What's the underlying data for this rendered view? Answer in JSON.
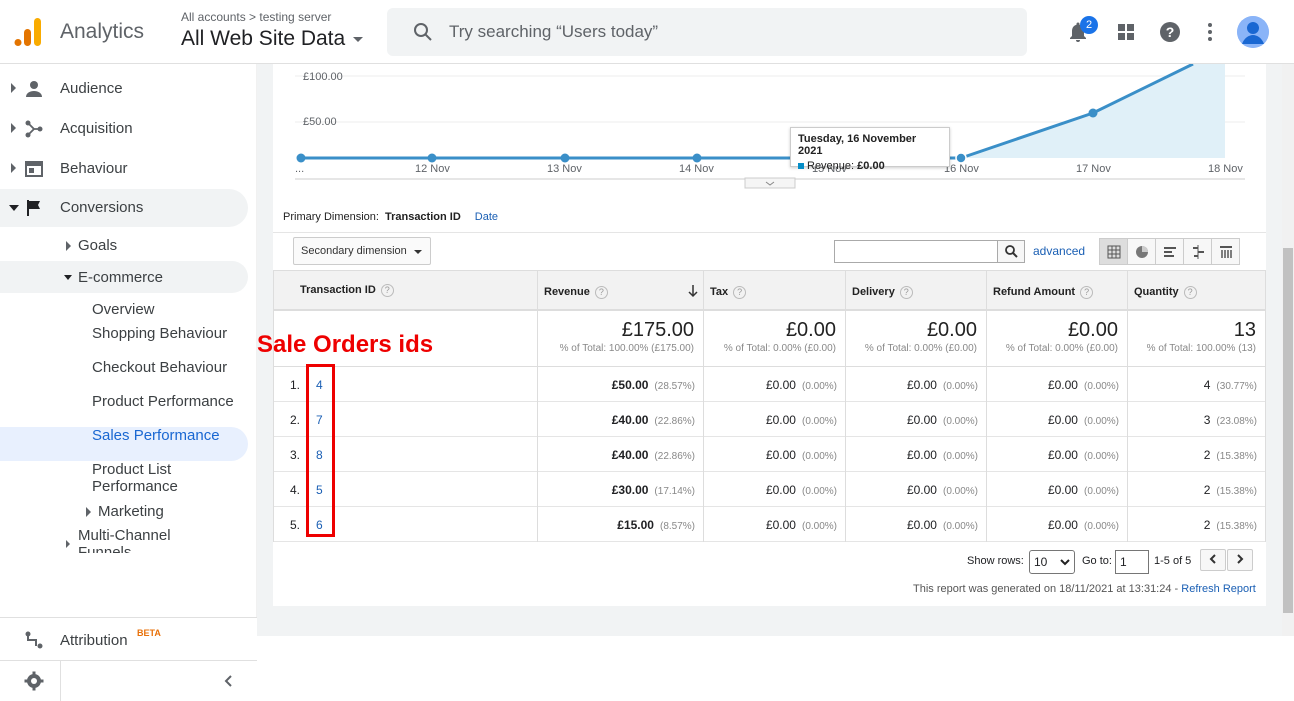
{
  "header": {
    "brand": "Analytics",
    "breadcrumb": "All accounts > testing server",
    "property": "All Web Site Data",
    "search_placeholder": "Try searching “Users today”",
    "notification_count": "2"
  },
  "sidebar": {
    "items": {
      "audience": "Audience",
      "acquisition": "Acquisition",
      "behaviour": "Behaviour",
      "conversions": "Conversions",
      "goals": "Goals",
      "ecommerce": "E-commerce",
      "overview": "Overview",
      "shopping_behaviour": "Shopping Behaviour",
      "checkout_behaviour": "Checkout Behaviour",
      "product_performance": "Product Performance",
      "sales_performance": "Sales Performance",
      "product_list_performance": "Product List Performance",
      "marketing": "Marketing",
      "multi_channel": "Multi-Channel Funnels",
      "attribution": "Attribution",
      "attribution_badge": "BETA"
    }
  },
  "chart": {
    "y_ticks": [
      "£100.00",
      "£50.00"
    ],
    "x_ticks": [
      "...",
      "12 Nov",
      "13 Nov",
      "14 Nov",
      "15 Nov",
      "16 Nov",
      "17 Nov",
      "18 Nov"
    ],
    "tooltip_date": "Tuesday, 16 November 2021",
    "tooltip_label": "Revenue:",
    "tooltip_value": "£0.00"
  },
  "controls": {
    "primary_dimension_label": "Primary Dimension:",
    "primary_dimension_selected": "Transaction ID",
    "primary_dimension_alt": "Date",
    "secondary_dimension": "Secondary dimension",
    "advanced": "advanced"
  },
  "table": {
    "columns": [
      "Transaction ID",
      "Revenue",
      "Tax",
      "Delivery",
      "Refund Amount",
      "Quantity"
    ],
    "totals": [
      {
        "value": "£175.00",
        "pct": "% of Total: 100.00% (£175.00)"
      },
      {
        "value": "£0.00",
        "pct": "% of Total: 0.00% (£0.00)"
      },
      {
        "value": "£0.00",
        "pct": "% of Total: 0.00% (£0.00)"
      },
      {
        "value": "£0.00",
        "pct": "% of Total: 0.00% (£0.00)"
      },
      {
        "value": "13",
        "pct": "% of Total: 100.00% (13)"
      }
    ],
    "rows": [
      {
        "n": "1.",
        "id": "4",
        "revenue": "£50.00",
        "revenue_pct": "(28.57%)",
        "tax": "£0.00",
        "tax_pct": "(0.00%)",
        "delivery": "£0.00",
        "delivery_pct": "(0.00%)",
        "refund": "£0.00",
        "refund_pct": "(0.00%)",
        "qty": "4",
        "qty_pct": "(30.77%)"
      },
      {
        "n": "2.",
        "id": "7",
        "revenue": "£40.00",
        "revenue_pct": "(22.86%)",
        "tax": "£0.00",
        "tax_pct": "(0.00%)",
        "delivery": "£0.00",
        "delivery_pct": "(0.00%)",
        "refund": "£0.00",
        "refund_pct": "(0.00%)",
        "qty": "3",
        "qty_pct": "(23.08%)"
      },
      {
        "n": "3.",
        "id": "8",
        "revenue": "£40.00",
        "revenue_pct": "(22.86%)",
        "tax": "£0.00",
        "tax_pct": "(0.00%)",
        "delivery": "£0.00",
        "delivery_pct": "(0.00%)",
        "refund": "£0.00",
        "refund_pct": "(0.00%)",
        "qty": "2",
        "qty_pct": "(15.38%)"
      },
      {
        "n": "4.",
        "id": "5",
        "revenue": "£30.00",
        "revenue_pct": "(17.14%)",
        "tax": "£0.00",
        "tax_pct": "(0.00%)",
        "delivery": "£0.00",
        "delivery_pct": "(0.00%)",
        "refund": "£0.00",
        "refund_pct": "(0.00%)",
        "qty": "2",
        "qty_pct": "(15.38%)"
      },
      {
        "n": "5.",
        "id": "6",
        "revenue": "£15.00",
        "revenue_pct": "(8.57%)",
        "tax": "£0.00",
        "tax_pct": "(0.00%)",
        "delivery": "£0.00",
        "delivery_pct": "(0.00%)",
        "refund": "£0.00",
        "refund_pct": "(0.00%)",
        "qty": "2",
        "qty_pct": "(15.38%)"
      }
    ]
  },
  "annotation": {
    "label": "Sale Orders ids"
  },
  "pager": {
    "show_rows_label": "Show rows:",
    "rows_value": "10",
    "goto_label": "Go to:",
    "goto_value": "1",
    "range": "1-5 of 5",
    "generated": "This report was generated on 18/11/2021 at 13:31:24 -",
    "refresh": "Refresh Report"
  },
  "colors": {
    "accent": "#1a73e8",
    "series": "#3a8fc8",
    "annotation": "#e00000"
  }
}
